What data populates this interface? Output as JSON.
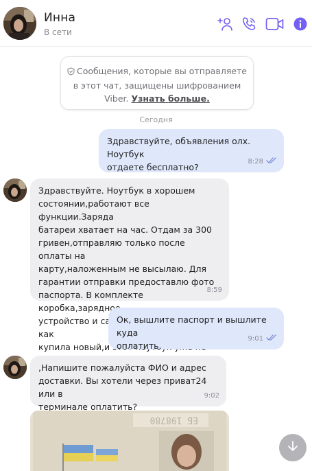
{
  "header": {
    "contact_name": "Инна",
    "status": "В сети",
    "icons": [
      "add-contact-icon",
      "phone-icon",
      "video-icon",
      "info-icon"
    ],
    "accent_color": "#7360f2"
  },
  "notice": {
    "line1": "Сообщения, которые вы отправляете",
    "line2": "в этот чат, защищены шифрованием",
    "line3_prefix": "Viber.",
    "link": "Узнать больше."
  },
  "date_separator": "Сегодня",
  "messages": [
    {
      "direction": "outgoing",
      "lines": [
        "Здравствуйте, объявления олх. Ноутбук",
        "отдаете бесплатно?"
      ],
      "time": "8:28",
      "status": "read"
    },
    {
      "direction": "incoming",
      "lines": [
        "Здравствуйте. Ноутбук в хорошем",
        "состоянии,работают все функции.Заряда",
        "батареи хватает на час. Отдам за 300",
        "гривен,отправляю только после оплаты на",
        "карту,наложенным не высылаю. Для",
        "гарантии отправки предоставлю фото",
        "паспорта. В комплекте коробка,зарядное",
        "устройство и сам ноутбук. Отдаю так как",
        "купила новый,и этот ноутбук уже не нужен)"
      ],
      "time": "8:59"
    },
    {
      "direction": "outgoing",
      "lines": [
        "Ок, вышлите паспорт и вышлите куда",
        "оплатить."
      ],
      "time": "9:01",
      "status": "read"
    },
    {
      "direction": "incoming",
      "lines": [
        ",Напишите пожалуйста ФИО и адрес",
        "доставки. Вы хотели через приват24 или в",
        "терминале оплатить?"
      ],
      "time": "9:02"
    }
  ],
  "photo": {
    "passport_number_text": "ЕБ 198780"
  },
  "colors": {
    "outgoing_bubble": "#dfe7fb",
    "incoming_bubble": "#eeeef1",
    "read_check": "#7a8fd6"
  }
}
